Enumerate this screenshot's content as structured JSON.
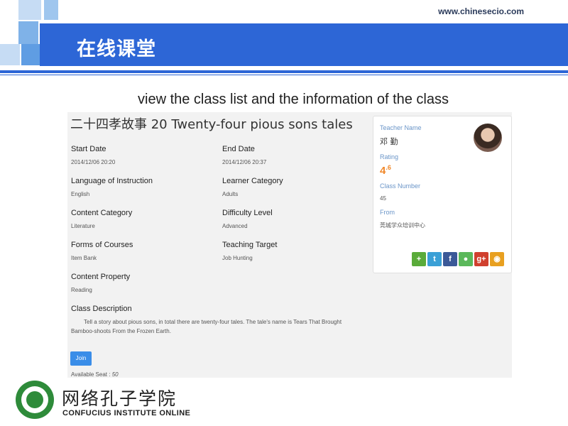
{
  "header": {
    "site_url": "www.chinesecio.com",
    "title": "在线课堂"
  },
  "subtitle": "view the class list and the information of the class",
  "course": {
    "title": "二十四孝故事 20 Twenty-four pious sons tales",
    "fields": [
      {
        "label": "Start Date",
        "value": "2014/12/06 20:20"
      },
      {
        "label": "End Date",
        "value": "2014/12/06 20:37"
      },
      {
        "label": "Language of Instruction",
        "value": "English"
      },
      {
        "label": "Learner Category",
        "value": "Adults"
      },
      {
        "label": "Content Category",
        "value": "Literature"
      },
      {
        "label": "Difficulty Level",
        "value": "Advanced"
      },
      {
        "label": "Forms of Courses",
        "value": "Item Bank"
      },
      {
        "label": "Teaching Target",
        "value": "Job Hunting"
      },
      {
        "label": "Content Property",
        "value": "Reading"
      }
    ],
    "description_label": "Class Description",
    "description": "Tell a story about pious sons, in total there are twenty-four tales. The tale's name is Tears That Brought Bamboo-shoots From the Frozen Earth.",
    "join_label": "Join",
    "seat_label": "Available Seat :",
    "seat_value": "50"
  },
  "teacher": {
    "name_label": "Teacher Name",
    "name": "邓 勤",
    "rating_label": "Rating",
    "rating_int": "4",
    "rating_frac": ".6",
    "class_number_label": "Class Number",
    "class_number": "45",
    "from_label": "From",
    "from": "莞城学众培训中心",
    "social_icons": [
      "plus-share-icon",
      "tencent-weibo-icon",
      "facebook-icon",
      "wechat-icon",
      "google-plus-icon",
      "sina-weibo-icon"
    ]
  },
  "logo": {
    "cn": "网络孔子学院",
    "en": "CONFUCIUS INSTITUTE ONLINE"
  },
  "colors": {
    "title_bar": "#2d66d6",
    "rating": "#f0882a",
    "join_button": "#3a8de8"
  }
}
